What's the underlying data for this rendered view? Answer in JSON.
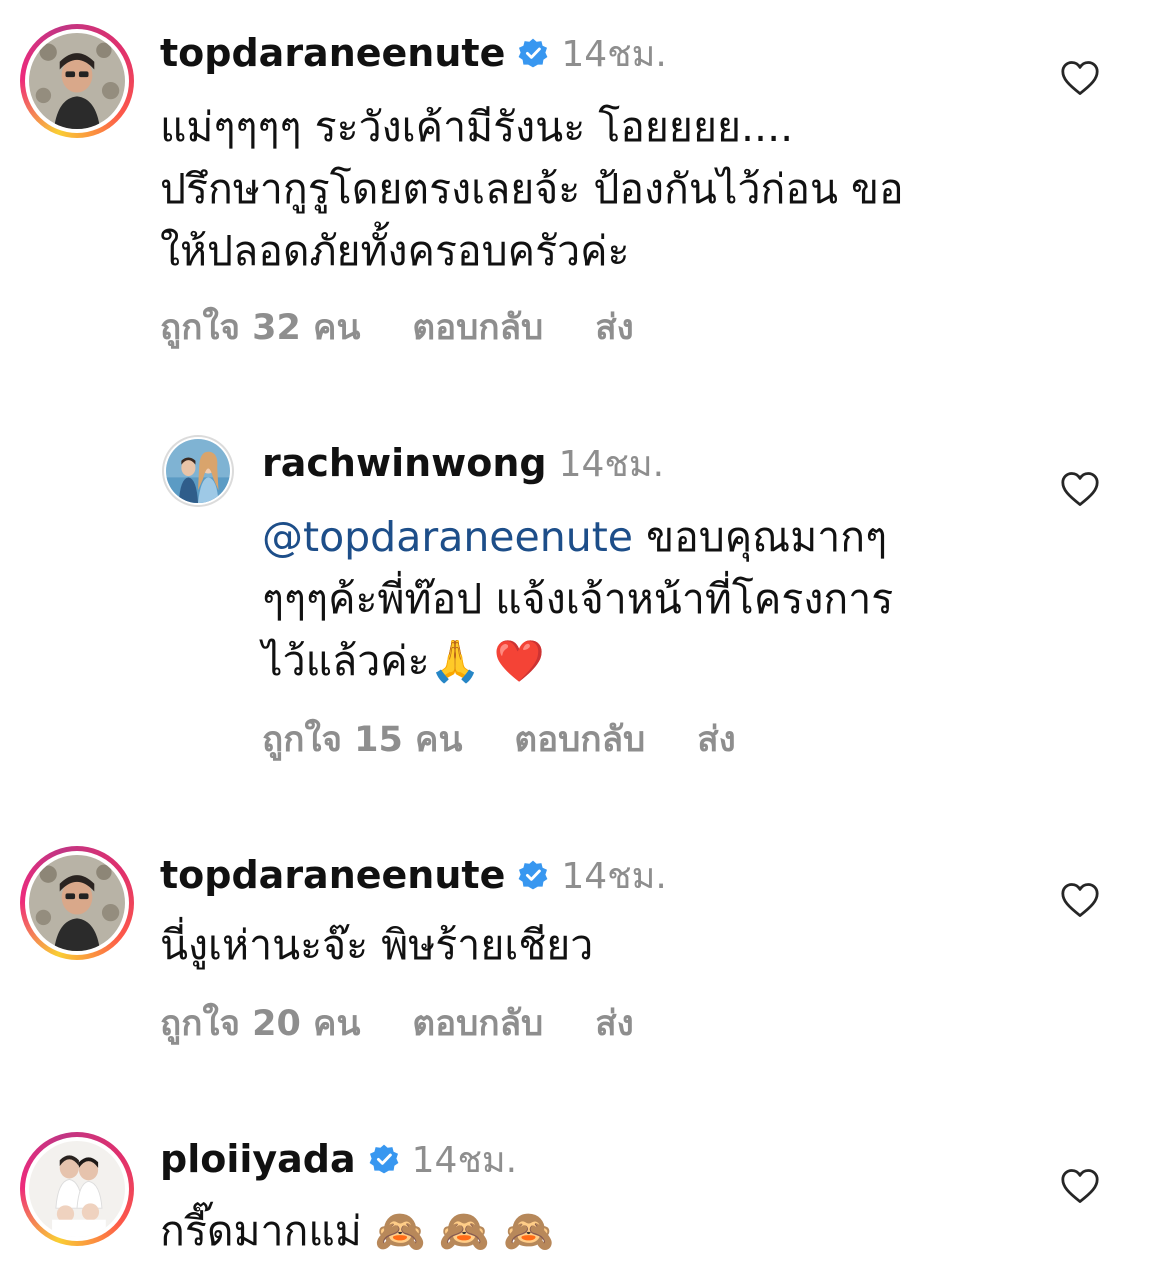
{
  "comments": [
    {
      "username": "topdaraneenute",
      "verified": true,
      "time": "14ชม.",
      "text_lines": [
        "แม่ๆๆๆๆ ระวังเค้ามีรังนะ โอยยยย....",
        "ปรึกษากูรูโดยตรงเลยจ้ะ ป้องกันไว้ก่อน ขอ",
        "ให้ปลอดภัยทั้งครอบครัวค่ะ"
      ],
      "likes": "ถูกใจ 32 คน",
      "reply": "ตอบกลับ",
      "send": "ส่ง"
    },
    {
      "username": "rachwinwong",
      "verified": false,
      "time": "14ชม.",
      "mention": "@topdaraneenute",
      "text_line1_rest": " ขอบคุณมากๆ",
      "text_line2": "ๆๆๆค้ะพี่ท๊อป แจ้งเจ้าหน้าที่โครงการ",
      "text_line3": "ไว้แล้วค่ะ🙏 ❤️",
      "likes": "ถูกใจ 15 คน",
      "reply": "ตอบกลับ",
      "send": "ส่ง"
    },
    {
      "username": "topdaraneenute",
      "verified": true,
      "time": "14ชม.",
      "text": "นี่งูเห่านะจ๊ะ พิษร้ายเชียว",
      "likes": "ถูกใจ 20 คน",
      "reply": "ตอบกลับ",
      "send": "ส่ง"
    },
    {
      "username": "ploiiyada",
      "verified": true,
      "time": "14ชม.",
      "text": "กรี๊ดมากแม่ 🙈 🙈 🙈"
    }
  ],
  "colors": {
    "username": "#111111",
    "meta": "#8e8e8e",
    "mention": "#1d4e89",
    "verified": "#3897f0"
  },
  "icons": [
    "verified-badge-icon",
    "heart-outline-icon"
  ]
}
